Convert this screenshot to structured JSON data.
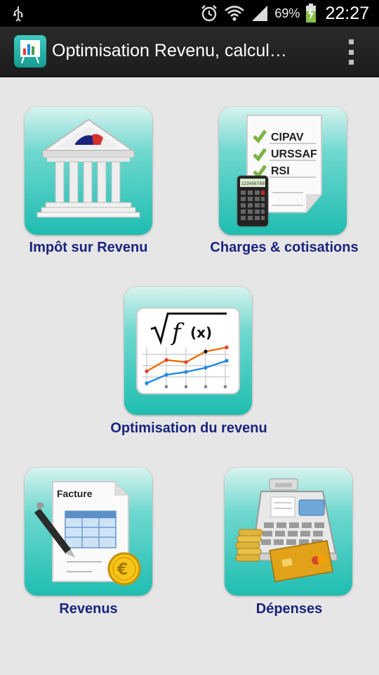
{
  "status_bar": {
    "battery_percent": "69%",
    "time": "22:27",
    "icons": [
      "usb-icon",
      "alarm-icon",
      "wifi-icon",
      "signal-icon",
      "battery-charging-icon"
    ]
  },
  "action_bar": {
    "title": "Optimisation Revenu, calcul…",
    "menu_icon": "overflow-menu-icon"
  },
  "tiles": [
    {
      "id": "impot",
      "label": "Impôt sur Revenu",
      "icon": "government-building-icon"
    },
    {
      "id": "charges",
      "label": "Charges & cotisations",
      "icon": "checklist-calculator-icon",
      "checklist": [
        "CIPAV",
        "URSSAF",
        "RSI"
      ],
      "calculator_display": "1234567890"
    },
    {
      "id": "optimisation",
      "label": "Optimisation du revenu",
      "icon": "function-chart-icon",
      "formula_sqrt": "√",
      "formula_f": "f",
      "formula_x": "(x)"
    },
    {
      "id": "revenus",
      "label": "Revenus",
      "icon": "invoice-pen-icon",
      "invoice_title": "Facture"
    },
    {
      "id": "depenses",
      "label": "Dépenses",
      "icon": "cash-register-icon"
    }
  ],
  "colors": {
    "label": "#1a237e",
    "tile_top": "#d8f3ef",
    "tile_bottom": "#1fbdb1",
    "background": "#e6e6e6"
  }
}
